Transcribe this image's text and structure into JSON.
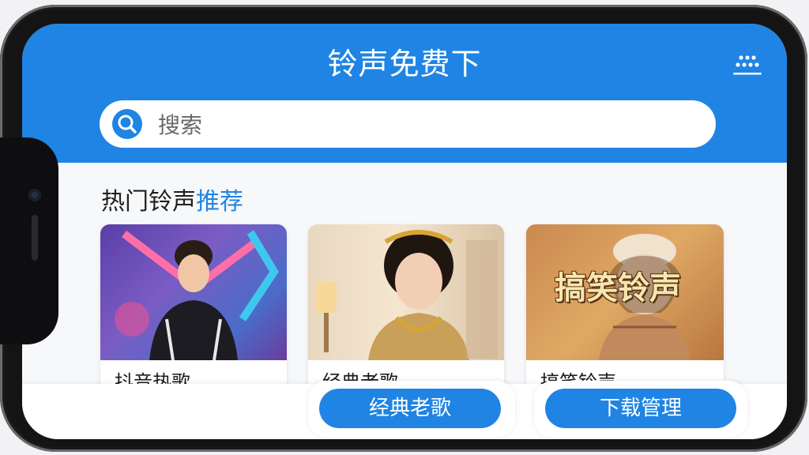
{
  "header": {
    "title": "铃声免费下",
    "grid_icon": "grid-dots-icon"
  },
  "search": {
    "placeholder": "搜索",
    "icon": "search-icon"
  },
  "section": {
    "title_main": "热门铃声",
    "title_accent": "推荐"
  },
  "cards": [
    {
      "label": "抖音热歌"
    },
    {
      "label": "经典老歌"
    },
    {
      "label": "搞笑铃声",
      "overlay": "搞笑铃声"
    }
  ],
  "bottom_tabs": [
    {
      "label": "经典老歌"
    },
    {
      "label": "下载管理"
    }
  ],
  "colors": {
    "accent": "#1f84e3",
    "background": "#f7f8fa"
  }
}
